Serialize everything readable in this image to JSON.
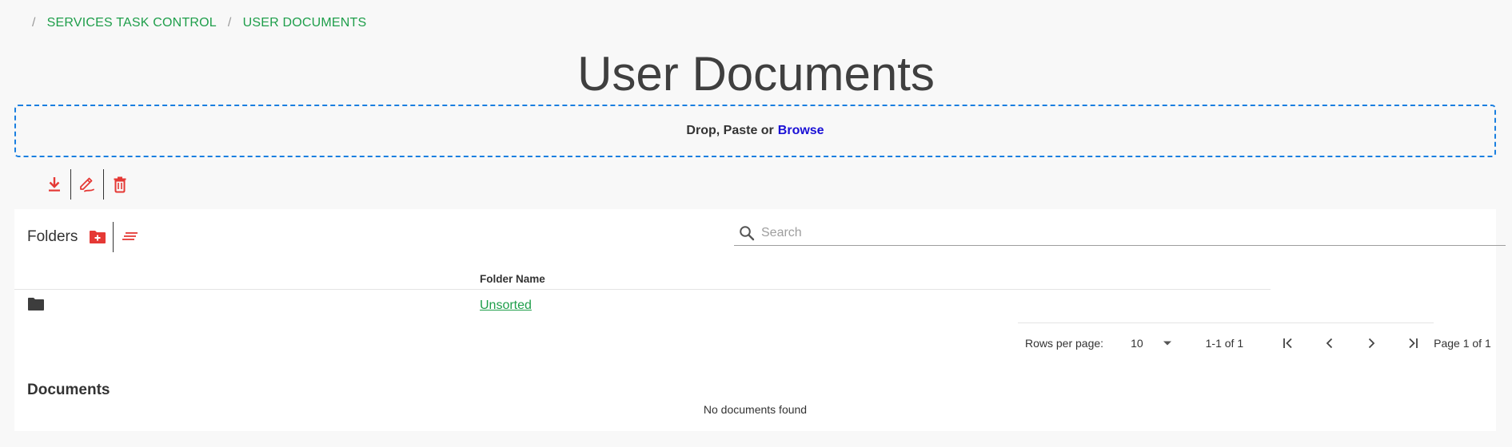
{
  "breadcrumb": {
    "separator": "/",
    "items": [
      {
        "label": "SERVICES TASK CONTROL"
      },
      {
        "label": "USER DOCUMENTS"
      }
    ]
  },
  "page_title": "User Documents",
  "dropzone": {
    "prefix": "Drop, Paste or",
    "browse_label": "Browse"
  },
  "toolbar_icons": [
    "download-icon",
    "edit-icon",
    "delete-icon"
  ],
  "folders": {
    "title": "Folders",
    "header_icons": [
      "folder-add-icon",
      "sort-icon"
    ],
    "search": {
      "placeholder": "Search",
      "value": ""
    },
    "column_header": "Folder Name",
    "rows": [
      {
        "icon": "folder-icon",
        "name": "Unsorted"
      }
    ],
    "pagination": {
      "rows_per_page_label": "Rows per page:",
      "rows_per_page_value": "10",
      "range": "1-1 of 1",
      "page_text": "Page 1 of 1"
    }
  },
  "documents": {
    "title": "Documents",
    "empty_text": "No documents found"
  },
  "colors": {
    "accent_red": "#e53935",
    "link_green": "#1e9e4a",
    "dropzone_border": "#1a7fe0",
    "browse_link": "#1a10d6"
  }
}
